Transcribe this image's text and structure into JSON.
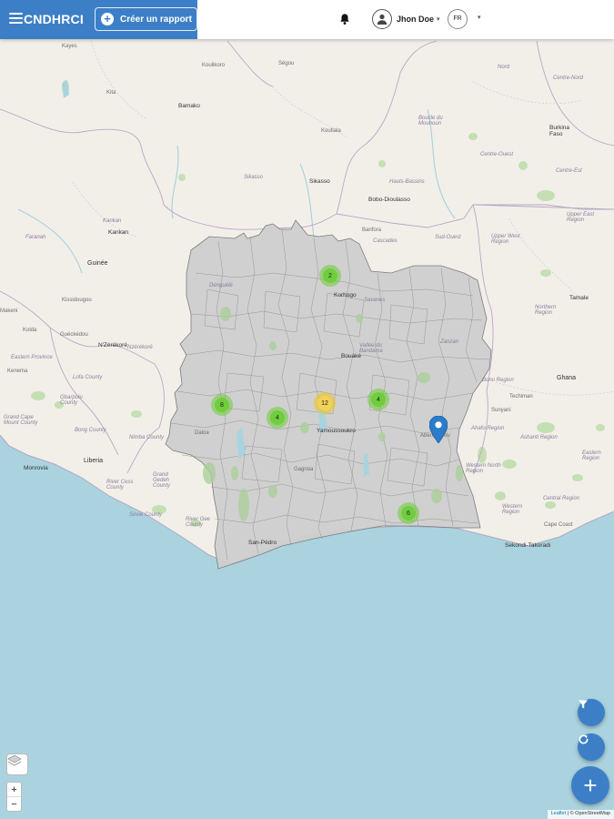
{
  "header": {
    "brand": "CNDHRCI",
    "create_report_label": "Créer un rapport",
    "user_name": "Jhon Doe",
    "language": "FR",
    "brand_color": "#3d7fc7"
  },
  "map": {
    "labels": {
      "kayes": "Kayes",
      "kita": "Kita",
      "koulikoro": "Koulikoro",
      "segou": "Ségou",
      "bamako": "Bamako",
      "nord": "Nord",
      "centre_nord": "Centre-Nord",
      "boucle": "Boucle du Mouhoun",
      "burkina": "Burkina Faso",
      "centre_ouest": "Centre-Ouest",
      "centre_est": "Centre-Est",
      "koutiala": "Koutiala",
      "sikasso_region": "Sikasso",
      "sikasso": "Sikasso",
      "hauts_bassins": "Hauts-Bassins",
      "bobo": "Bobo-Dioulasso",
      "banfora": "Banfora",
      "cascades": "Cascades",
      "sud_ouest": "Sud-Ouest",
      "upper_east": "Upper East Region",
      "upper_west": "Upper West Region",
      "kankan_region": "Kankan",
      "kankan": "Kankan",
      "faranah": "Faranah",
      "guinee": "Guinée",
      "denguele": "Denguélé",
      "korhogo": "Korhogo",
      "savanes": "Savanes",
      "tamale": "Tamale",
      "northern": "Northern Region",
      "kissidougou": "Kissidougou",
      "kolda": "Kolda",
      "gueckedou": "Guéckédou",
      "makeni": "Makeni",
      "nzerekore_region": "Nzérékoré",
      "nzerekore": "N'Zérékoré",
      "kenema": "Kenema",
      "eastern": "Eastern Province",
      "lofa": "Lofa County",
      "vallee": "Vallée du Bandama",
      "bouake": "Bouaké",
      "zanzan": "Zanzan",
      "bono": "Bono Region",
      "ghana": "Ghana",
      "techiman": "Techiman",
      "gbarpolu": "Gbarpolu County",
      "bong": "Bong County",
      "grand_cape": "Grand Cape Mount County",
      "nimba": "Nimba County",
      "yamoussoukro": "Yamoussoukro",
      "sunyani": "Sunyani",
      "ahafo": "Ahafo Region",
      "ashanti": "Ashanti Region",
      "monrovia": "Monrovia",
      "liberia": "Liberia",
      "abengourou": "Abengourou",
      "eastern_gh": "Eastern Region",
      "daloa": "Daloa",
      "rivercess": "River Cess County",
      "grand_gedeh": "Grand Gedeh County",
      "western_north": "Western North Region",
      "sinoe": "Sinoe County",
      "rivergee": "River Gee County",
      "western": "Western Region",
      "central": "Central Region",
      "capecoast": "Cape Coast",
      "sanpedro": "San-Pédro",
      "sekondi": "Sekondi-Takoradi",
      "gagnoa": "Gagnoa"
    },
    "clusters": [
      {
        "name": "cluster-korhogo",
        "count": "2",
        "color": "green"
      },
      {
        "name": "cluster-man",
        "count": "8",
        "color": "green"
      },
      {
        "name": "cluster-daloa",
        "count": "4",
        "color": "green"
      },
      {
        "name": "cluster-yamoussoukro",
        "count": "12",
        "color": "yellow"
      },
      {
        "name": "cluster-east",
        "count": "4",
        "color": "green"
      },
      {
        "name": "cluster-abidjan",
        "count": "6",
        "color": "green"
      }
    ],
    "attribution_leaflet": "Leaflet",
    "attribution_osm": "| © OpenStreetMap",
    "zoom_in": "+",
    "zoom_out": "−",
    "colors": {
      "land": "#f2efe9",
      "sea": "#aad3df",
      "country_fill": "#cfcfcf",
      "cluster_small": "#6ecc39",
      "cluster_medium": "#f0c20c",
      "marker": "#2b7ccb"
    }
  },
  "fab": {
    "add_label": "+"
  }
}
